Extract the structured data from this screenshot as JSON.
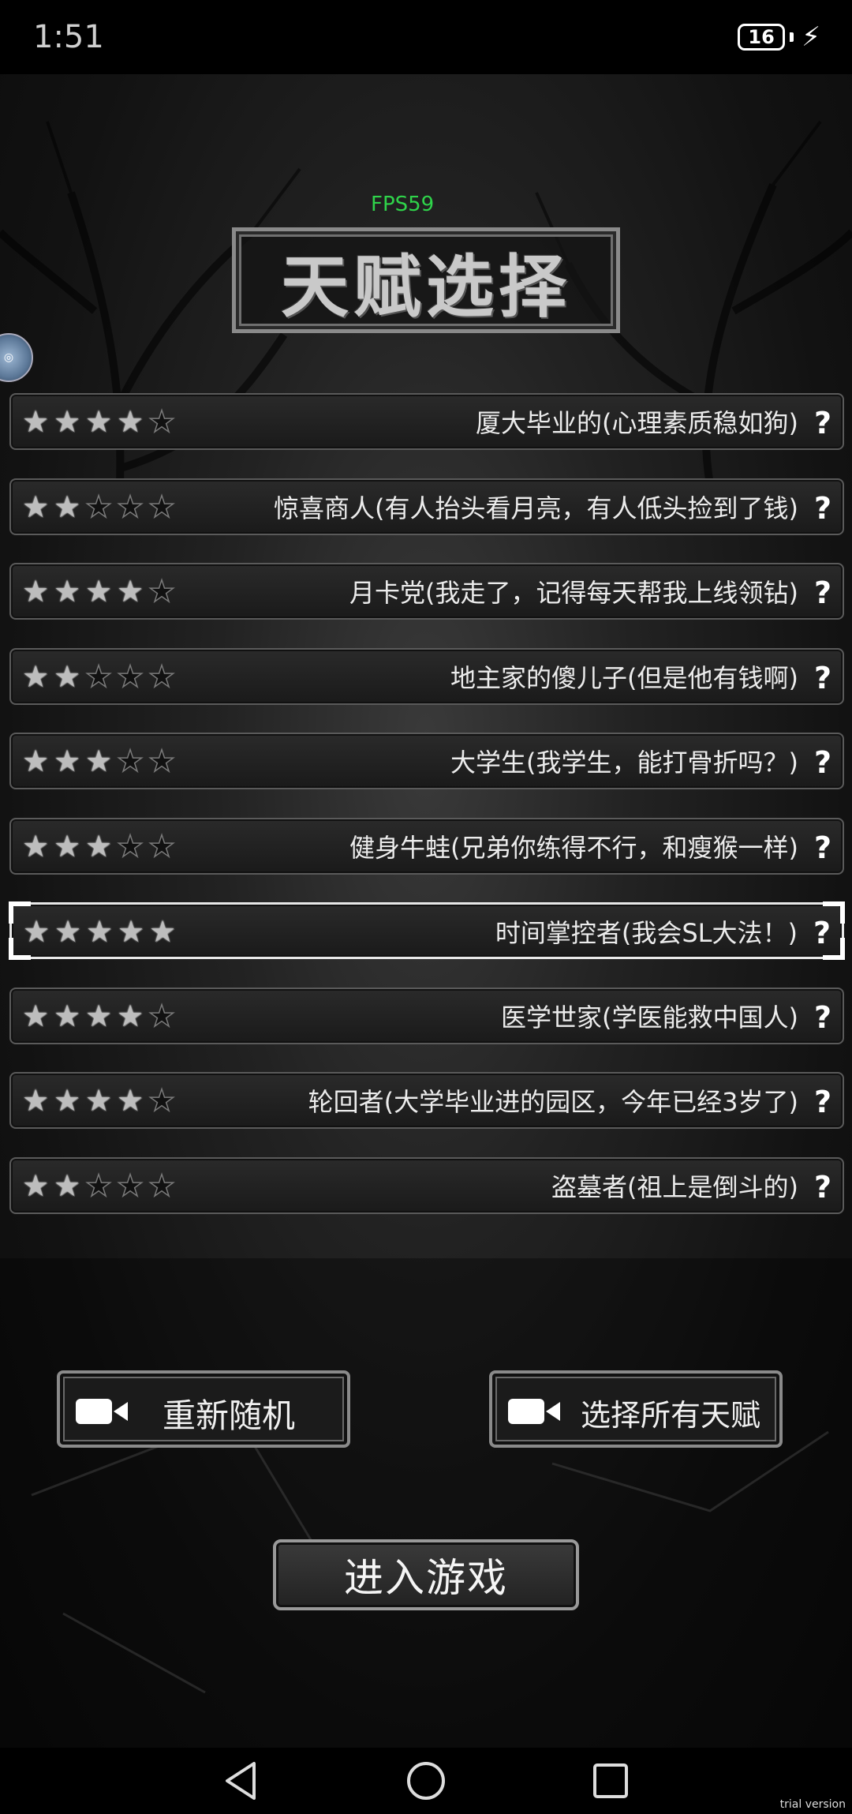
{
  "status_bar": {
    "time": "1:51",
    "battery": "16"
  },
  "fps_label": "FPS59",
  "title": "天赋选择",
  "talents": [
    {
      "label": "厦大毕业的(心理素质稳如狗)",
      "rating": 4,
      "max": 5
    },
    {
      "label": "惊喜商人(有人抬头看月亮，有人低头捡到了钱)",
      "rating": 2,
      "max": 5
    },
    {
      "label": "月卡党(我走了，记得每天帮我上线领钻)",
      "rating": 4,
      "max": 5
    },
    {
      "label": "地主家的傻儿子(但是他有钱啊)",
      "rating": 2,
      "max": 5
    },
    {
      "label": "大学生(我学生，能打骨折吗？)",
      "rating": 3,
      "max": 5
    },
    {
      "label": "健身牛蛙(兄弟你练得不行，和瘦猴一样)",
      "rating": 3,
      "max": 5
    },
    {
      "label": "时间掌控者(我会SL大法！)",
      "rating": 5,
      "max": 5,
      "selected": true
    },
    {
      "label": "医学世家(学医能救中国人)",
      "rating": 4,
      "max": 5
    },
    {
      "label": "轮回者(大学毕业进的园区，今年已经3岁了)",
      "rating": 4,
      "max": 5
    },
    {
      "label": "盗墓者(祖上是倒斗的)",
      "rating": 2,
      "max": 5
    }
  ],
  "help_glyph": "?",
  "buttons": {
    "reroll": "重新随机",
    "select_all": "选择所有天赋",
    "enter": "进入游戏"
  },
  "watermark": "trial version",
  "icons": {
    "ad_button": "video-camera-icon",
    "help": "question-icon",
    "nav_back": "triangle-back-icon",
    "nav_home": "circle-home-icon",
    "nav_recent": "square-recent-icon"
  }
}
